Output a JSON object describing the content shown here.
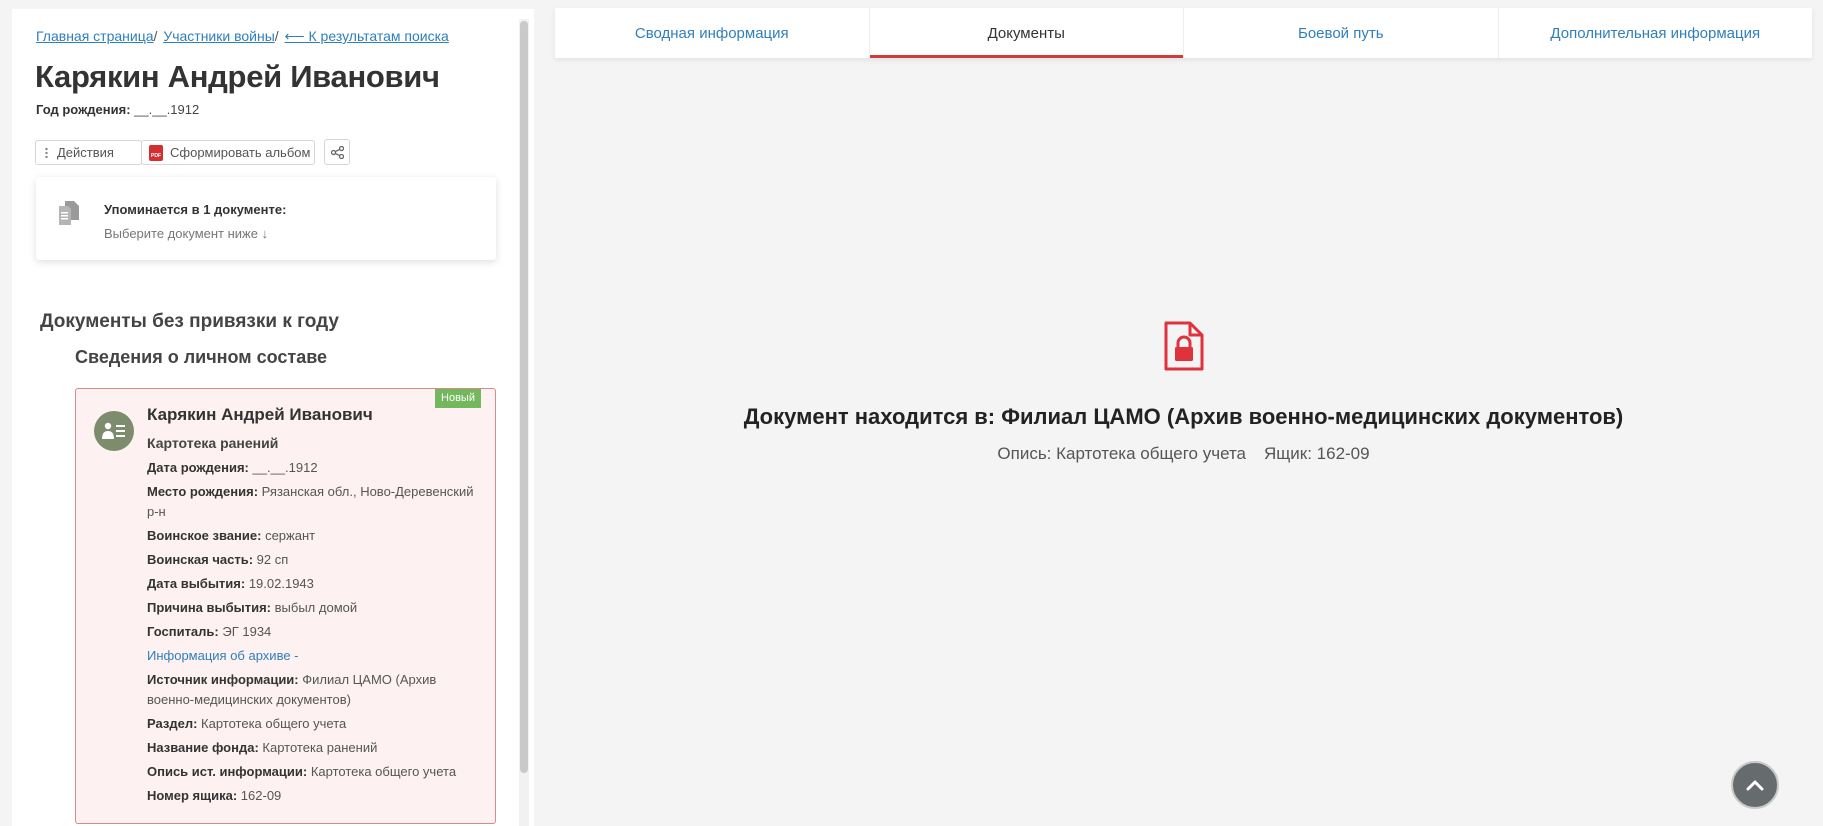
{
  "breadcrumb": {
    "home": "Главная страница",
    "participants": "Участники войны",
    "back": "⟵ К результатам поиска",
    "sep": "/"
  },
  "person": {
    "name": "Карякин Андрей Иванович",
    "birth_label": "Год рождения:",
    "birth_value": "__.__.1912"
  },
  "actions": {
    "actions_label": "Действия",
    "album_label": "Сформировать альбом"
  },
  "mention": {
    "title": "Упоминается в 1 документе:",
    "subtitle": "Выберите документ ниже ↓"
  },
  "sections": {
    "no_year": "Документы без привязки к году",
    "personnel": "Сведения о личном составе"
  },
  "doc_card": {
    "badge": "Новый",
    "name": "Карякин Андрей Иванович",
    "type": "Картотека ранений",
    "fields": [
      {
        "label": "Дата рождения:",
        "value": "__.__.1912"
      },
      {
        "label": "Место рождения:",
        "value": "Рязанская обл., Ново-Деревенский р-н"
      },
      {
        "label": "Воинское звание:",
        "value": "сержант"
      },
      {
        "label": "Воинская часть:",
        "value": "92 сп"
      },
      {
        "label": "Дата выбытия:",
        "value": "19.02.1943"
      },
      {
        "label": "Причина выбытия:",
        "value": "выбыл домой"
      },
      {
        "label": "Госпиталь:",
        "value": "ЭГ 1934"
      }
    ],
    "archive_link": "Информация об архиве -",
    "archive_fields": [
      {
        "label": "Источник информации:",
        "value": "Филиал ЦАМО (Архив военно-медицинских документов)"
      },
      {
        "label": "Раздел:",
        "value": "Картотека общего учета"
      },
      {
        "label": "Название фонда:",
        "value": "Картотека ранений"
      },
      {
        "label": "Опись ист. информации:",
        "value": "Картотека общего учета"
      },
      {
        "label": "Номер ящика:",
        "value": "162-09"
      }
    ]
  },
  "tabs": [
    {
      "label": "Сводная информация",
      "active": false
    },
    {
      "label": "Документы",
      "active": true
    },
    {
      "label": "Боевой путь",
      "active": false
    },
    {
      "label": "Дополнительная информация",
      "active": false
    }
  ],
  "document_view": {
    "location": "Документ находится в: Филиал ЦАМО (Архив военно-медицинских документов)",
    "inventory": "Опись: Картотека общего учета",
    "box": "Ящик: 162-09"
  },
  "colors": {
    "link": "#2f7fbc",
    "accent_red": "#d33b3b",
    "badge_green": "#74b85d",
    "card_bg": "#fdf1f1",
    "card_border": "#d68b8b"
  },
  "icons": {
    "document": "document-copy-icon",
    "pdf": "pdf-icon",
    "share": "share-icon",
    "person": "person-card-icon",
    "locked_document": "locked-document-icon",
    "scroll_top": "chevron-up-icon"
  }
}
